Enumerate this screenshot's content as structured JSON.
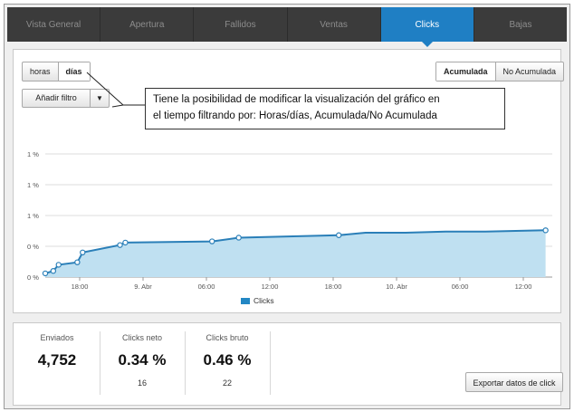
{
  "tabs": [
    {
      "label": "Vista General",
      "active": false
    },
    {
      "label": "Apertura",
      "active": false
    },
    {
      "label": "Fallidos",
      "active": false
    },
    {
      "label": "Ventas",
      "active": false
    },
    {
      "label": "Clicks",
      "active": true
    },
    {
      "label": "Bajas",
      "active": false
    }
  ],
  "time_toggle": {
    "horas": "horas",
    "dias": "días",
    "selected": "horas"
  },
  "mode_toggle": {
    "acumulada": "Acumulada",
    "no_acumulada": "No Acumulada",
    "selected": "Acumulada"
  },
  "filter": {
    "label": "Añadir filtro"
  },
  "callout": {
    "line1": "Tiene la posibilidad de modificar la visualización del gráfico en",
    "line2": "el tiempo filtrando por:  Horas/días, Acumulada/No Acumulada"
  },
  "colors": {
    "accent": "#1f7fc4",
    "line": "#2a7fb8",
    "area": "#bfe0f1",
    "tabs_bg": "#3b3b3b"
  },
  "chart_data": {
    "type": "area",
    "series": [
      {
        "name": "Clicks",
        "values": [
          0.03,
          0.05,
          0.1,
          0.12,
          0.2,
          0.26,
          0.28,
          0.29,
          0.32,
          0.34,
          0.36,
          0.36,
          0.37,
          0.37,
          0.38
        ]
      }
    ],
    "x_positions": [
      0.0,
      0.6,
      1.0,
      2.4,
      2.8,
      5.6,
      6.0,
      12.5,
      14.5,
      22.0,
      24.0,
      27.0,
      30.0,
      33.0,
      37.5
    ],
    "x_ticks": [
      "18:00",
      "9. Abr",
      "06:00",
      "12:00",
      "18:00",
      "10. Abr",
      "06:00",
      "12:00"
    ],
    "y_ticks": [
      "0 %",
      "0 %",
      "1 %",
      "1 %",
      "1 %"
    ],
    "ylim": [
      0,
      1
    ],
    "grid": true,
    "legend": "bottom-center",
    "markers": [
      0,
      1,
      2,
      3,
      4,
      5,
      6,
      7,
      8,
      9,
      14
    ]
  },
  "stats": [
    {
      "label": "Enviados",
      "value": "4,752",
      "sub": ""
    },
    {
      "label": "Clicks neto",
      "value": "0.34 %",
      "sub": "16"
    },
    {
      "label": "Clicks bruto",
      "value": "0.46 %",
      "sub": "22"
    }
  ],
  "export_button": {
    "label": "Exportar datos de click"
  }
}
